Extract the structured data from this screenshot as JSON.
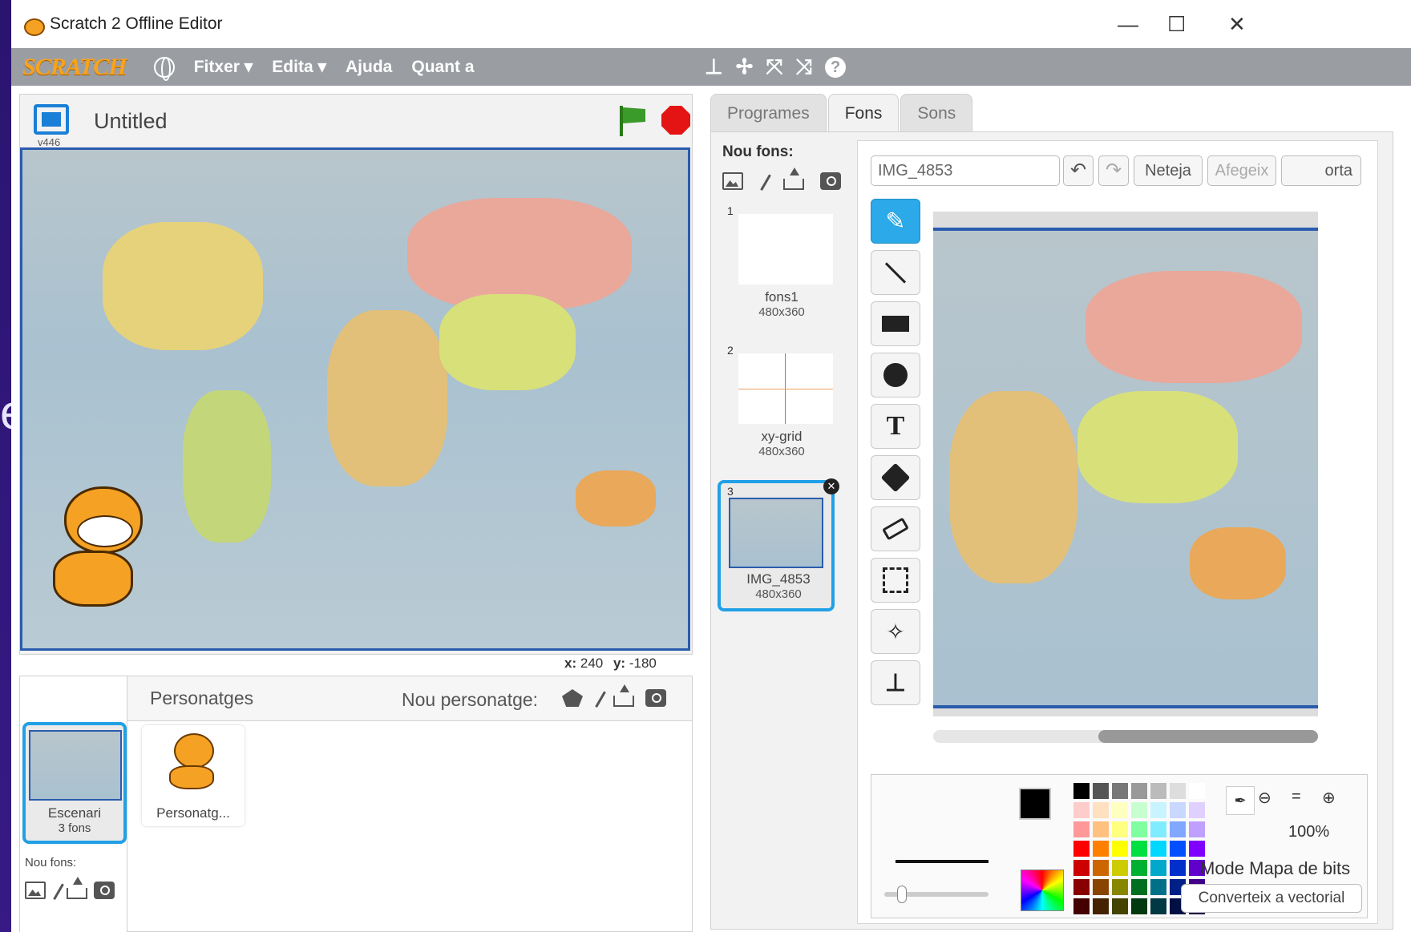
{
  "window": {
    "title": "Scratch 2 Offline Editor",
    "controls": {
      "minimize": "—",
      "maximize": "☐",
      "close": "✕"
    }
  },
  "menubar": {
    "logo": "SCRATCH",
    "items": [
      "Fitxer ▾",
      "Edita ▾",
      "Ajuda",
      "Quant a"
    ],
    "tool_icons": [
      "stamp-icon",
      "cut-icon",
      "grow-icon",
      "shrink-icon",
      "help-icon"
    ]
  },
  "stage": {
    "version": "v446",
    "project_name": "Untitled",
    "coords": {
      "x_label": "x:",
      "x_value": "240",
      "y_label": "y:",
      "y_value": "-180"
    }
  },
  "sprites": {
    "title": "Personatges",
    "new_label": "Nou personatge:",
    "stage_tile": {
      "name": "Escenari",
      "sub": "3 fons"
    },
    "new_backdrop_label": "Nou fons:",
    "items": [
      {
        "name": "Personatg..."
      }
    ]
  },
  "tabs": [
    {
      "label": "Programes",
      "active": false
    },
    {
      "label": "Fons",
      "active": true
    },
    {
      "label": "Sons",
      "active": false
    }
  ],
  "backdrops": {
    "new_label": "Nou fons:",
    "items": [
      {
        "num": "1",
        "name": "fons1",
        "size": "480x360",
        "selected": false
      },
      {
        "num": "2",
        "name": "xy-grid",
        "size": "480x360",
        "selected": false
      },
      {
        "num": "3",
        "name": "IMG_4853",
        "size": "480x360",
        "selected": true
      }
    ]
  },
  "editor": {
    "name_value": "IMG_4853",
    "clear_label": "Neteja",
    "add_label": "Afegeix",
    "import_label": "orta",
    "zoom": "100%",
    "mode_label": "Mode Mapa de bits",
    "convert_label": "Converteix a vectorial",
    "colors": {
      "row1": [
        "#000000",
        "#555555",
        "#777777",
        "#999999",
        "#bbbbbb",
        "#dddddd",
        "#ffffff"
      ],
      "row2": [
        "#ffcccc",
        "#ffe0c0",
        "#ffffc0",
        "#c8ffd0",
        "#c8f4ff",
        "#c8d8ff",
        "#e0d0ff"
      ],
      "row3": [
        "#ff9999",
        "#ffc080",
        "#ffff80",
        "#80ffa0",
        "#80ecff",
        "#80a8ff",
        "#c0a0ff"
      ],
      "row4": [
        "#ff0000",
        "#ff8000",
        "#ffff00",
        "#00e040",
        "#00d8ff",
        "#0050ff",
        "#8000ff"
      ],
      "row5": [
        "#cc0000",
        "#cc6600",
        "#cccc00",
        "#00b030",
        "#00a8cc",
        "#0030cc",
        "#6000cc"
      ],
      "row6": [
        "#880000",
        "#884400",
        "#888800",
        "#007020",
        "#007088",
        "#002088",
        "#400088"
      ],
      "row7": [
        "#440000",
        "#442200",
        "#444400",
        "#003810",
        "#003844",
        "#001044",
        "#200044"
      ]
    },
    "accent": "#2ba9e8"
  }
}
